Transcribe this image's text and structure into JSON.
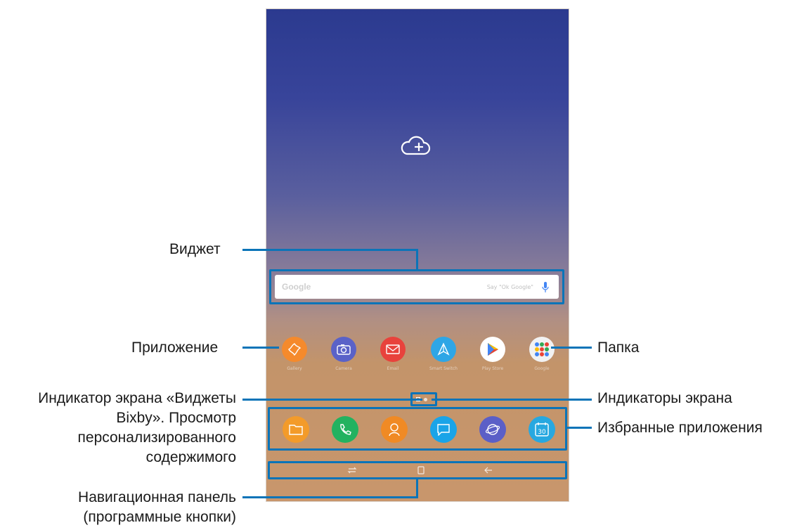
{
  "callouts": {
    "widget": "Виджет",
    "app": "Приложение",
    "bixby": [
      "Индикатор экрана «Виджеты",
      "Bixby». Просмотр",
      "персонализированного",
      "содержимого"
    ],
    "navbar": [
      "Навигационная панель",
      "(программные кнопки)"
    ],
    "folder": "Папка",
    "indicators": "Индикаторы экрана",
    "favorites": "Избранные приложения"
  },
  "widget": {
    "logo": "Google",
    "hint": "Say \"Ok Google\""
  },
  "apps": [
    {
      "name": "Gallery",
      "icon": "gallery-icon",
      "color": "#f58a2c"
    },
    {
      "name": "Camera",
      "icon": "camera-icon",
      "color": "#5a62c8"
    },
    {
      "name": "Email",
      "icon": "email-icon",
      "color": "#e8423c"
    },
    {
      "name": "Smart Switch",
      "icon": "send-icon",
      "color": "#2ea6e6"
    },
    {
      "name": "Play Store",
      "icon": "play-store-icon",
      "color": "#ffffff"
    },
    {
      "name": "Google",
      "icon": "google-folder-icon",
      "color": "#f2f2f2"
    }
  ],
  "dock": [
    {
      "icon": "folder-icon",
      "color": "#f39b2a"
    },
    {
      "icon": "phone-icon",
      "color": "#22b260"
    },
    {
      "icon": "contacts-icon",
      "color": "#f08a24"
    },
    {
      "icon": "messages-icon",
      "color": "#1aa4e8"
    },
    {
      "icon": "internet-icon",
      "color": "#5b5fc7"
    },
    {
      "icon": "calendar-icon",
      "color": "#27a8e0",
      "text": "30"
    }
  ],
  "colors": {
    "accent": "#0b74b8"
  }
}
